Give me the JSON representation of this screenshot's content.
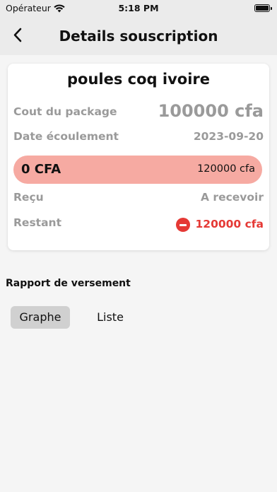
{
  "status_bar": {
    "carrier": "Opérateur",
    "time": "5:18 PM"
  },
  "nav": {
    "title": "Details souscription"
  },
  "card": {
    "package_name": "poules coq ivoire",
    "cost_label": "Cout du package",
    "cost_value": "100000 cfa",
    "date_label": "Date écoulement",
    "date_value": "2023-09-20",
    "progress": {
      "paid_label": "0 CFA",
      "total_label": "120000 cfa",
      "fraction_paid": 0
    },
    "received_label": "Reçu",
    "received_value": "A recevoir",
    "remaining_label": "Restant",
    "remaining_value": "120000 cfa"
  },
  "report": {
    "title": "Rapport de versement",
    "tabs": [
      {
        "label": "Graphe",
        "selected": true
      },
      {
        "label": "Liste",
        "selected": false
      }
    ]
  },
  "colors": {
    "progress_bg": "#f6aaa2",
    "remaining_red": "#e53935",
    "selected_tab_bg": "#d0d0d0"
  },
  "icons": [
    "wifi-icon",
    "battery-icon",
    "back-chevron-icon",
    "minus-circle-icon"
  ]
}
